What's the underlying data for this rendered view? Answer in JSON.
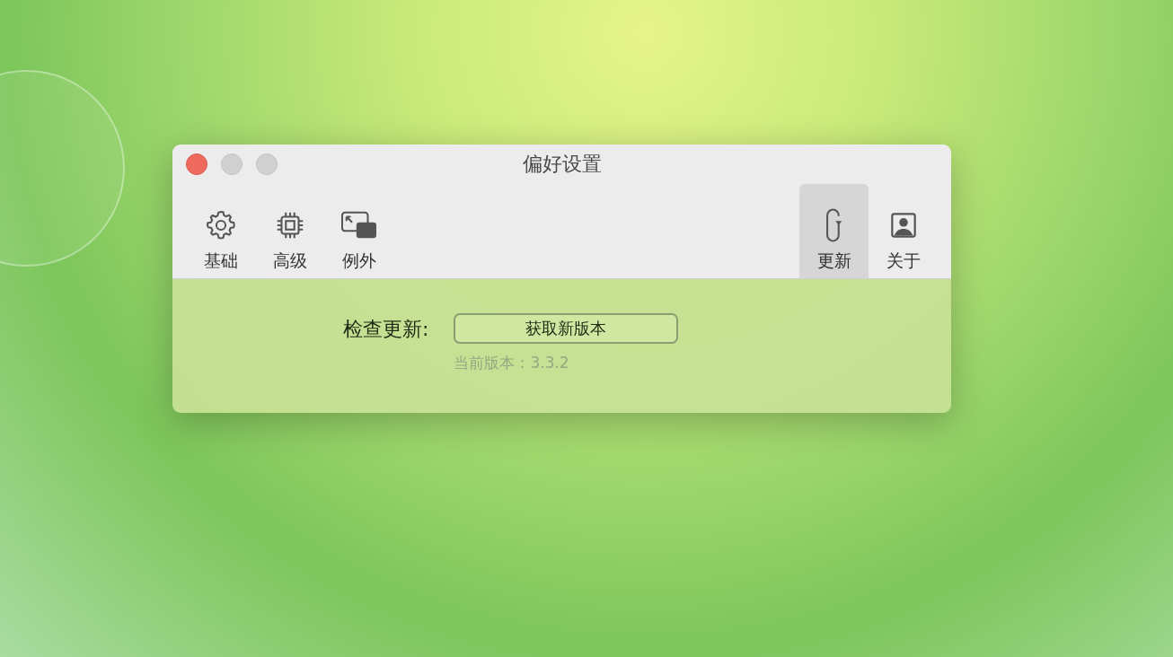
{
  "window": {
    "title": "偏好设置"
  },
  "toolbar": {
    "left": [
      {
        "label": "基础",
        "selected": false
      },
      {
        "label": "高级",
        "selected": false
      },
      {
        "label": "例外",
        "selected": false
      }
    ],
    "right": [
      {
        "label": "更新",
        "selected": true
      },
      {
        "label": "关于",
        "selected": false
      }
    ]
  },
  "update": {
    "label": "检查更新:",
    "button": "获取新版本",
    "version": "当前版本：3.3.2"
  }
}
